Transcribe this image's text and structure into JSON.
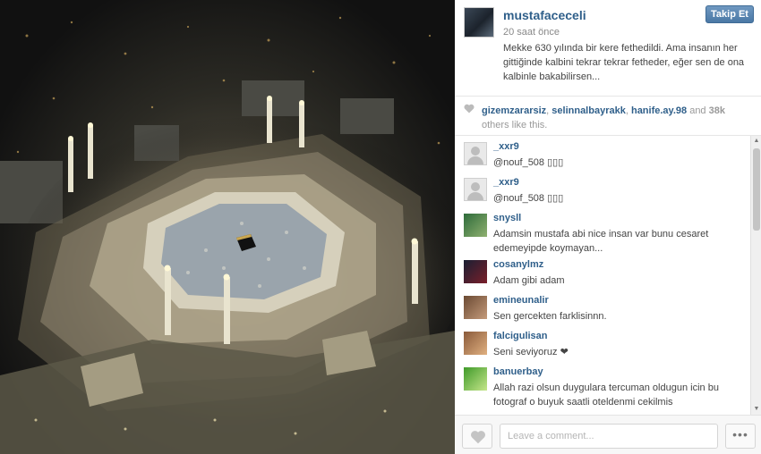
{
  "post": {
    "username": "mustafaceceli",
    "timestamp": "20 saat önce",
    "follow_label": "Takip Et",
    "caption": "Mekke 630 yılında bir kere fethedildi. Ama insanın her gittiğinde kalbini tekrar tekrar fetheder, eğer sen de ona kalbinle bakabilirsen..."
  },
  "likes": {
    "likers": [
      "gizemzararsiz",
      "selinnalbayrakk",
      "hanife.ay.98"
    ],
    "separator": ", ",
    "and_text": " and ",
    "count": "38k",
    "suffix": " others like this."
  },
  "comments": [
    {
      "user": "_xxr9",
      "text": "@nouf_508 ▯▯▯",
      "avatar": "generic"
    },
    {
      "user": "_xxr9",
      "text": "@nouf_508 ▯▯▯",
      "avatar": "generic"
    },
    {
      "user": "snysll",
      "text": "Adamsin mustafa abi nice insan var bunu cesaret edemeyipde koymayan...",
      "avatar": "photo-green"
    },
    {
      "user": "cosanylmz",
      "text": "Adam gibi adam",
      "avatar": "photo-dark"
    },
    {
      "user": "emineunalir",
      "text": "Sen gercekten farklisinnn.",
      "avatar": "photo-face"
    },
    {
      "user": "falcigulisan",
      "text": "Seni seviyoruz ❤",
      "avatar": "photo-warm"
    },
    {
      "user": "banuerbay",
      "text": "Allah razi olsun duygulara tercuman oldugun icin bu fotograf o buyuk saatli oteldenmi cekilmis",
      "avatar": "photo-lime"
    }
  ],
  "footer": {
    "comment_placeholder": "Leave a comment...",
    "more_label": "•••"
  },
  "icons": {
    "heart": "heart-icon",
    "more": "more-icon"
  },
  "colors": {
    "link": "#2f5f8a",
    "follow_button": "#4a78a5"
  }
}
